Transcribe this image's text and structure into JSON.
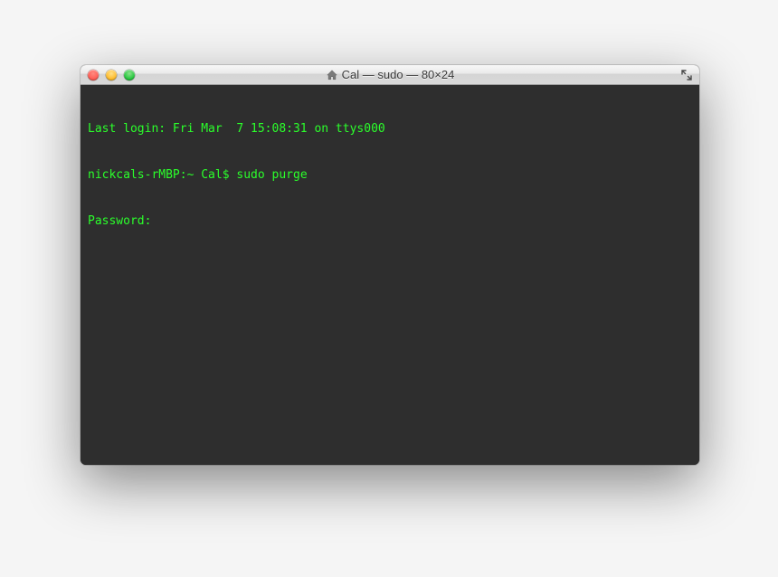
{
  "window": {
    "title": "Cal — sudo — 80×24"
  },
  "terminal": {
    "line1": "Last login: Fri Mar  7 15:08:31 on ttys000",
    "prompt": "nickcals-rMBP:~ Cal$ ",
    "command": "sudo purge",
    "password_label": "Password:"
  }
}
